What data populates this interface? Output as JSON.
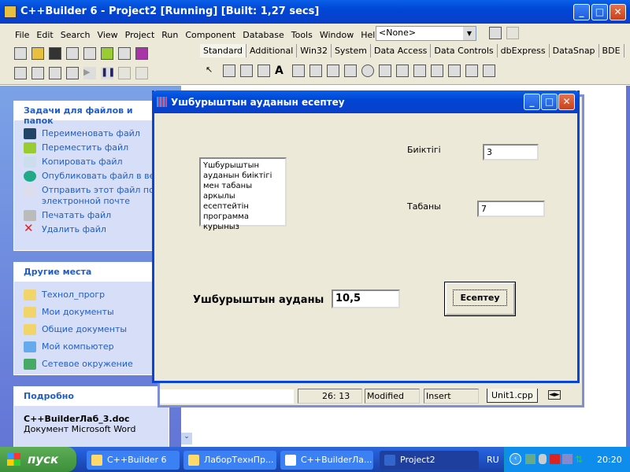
{
  "ide": {
    "title": "C++Builder 6 - Project2 [Running] [Built: 1,27 secs]",
    "menu": [
      "File",
      "Edit",
      "Search",
      "View",
      "Project",
      "Run",
      "Component",
      "Database",
      "Tools",
      "Window",
      "Help"
    ],
    "config_select": "<None>",
    "palette_tabs": [
      "Standard",
      "Additional",
      "Win32",
      "System",
      "Data Access",
      "Data Controls",
      "dbExpress",
      "DataSnap",
      "BDE"
    ],
    "status": {
      "position": "26:  13",
      "modified": "Modified",
      "mode": "Insert",
      "tab": "Unit1.cpp"
    }
  },
  "explorer": {
    "tasks": {
      "title": "Задачи для файлов и папок",
      "items": [
        "Переименовать файл",
        "Переместить файл",
        "Копировать файл",
        "Опубликовать файл в вебе",
        "Отправить этот файл по электронной почте",
        "Печатать файл",
        "Удалить файл"
      ]
    },
    "places": {
      "title": "Другие места",
      "items": [
        "Технол_прогр",
        "Мои документы",
        "Общие документы",
        "Мой компьютер",
        "Сетевое окружение"
      ]
    },
    "details": {
      "title": "Подробно",
      "filename": "C++BuilderЛаб_3.doc",
      "filetype": "Документ Microsoft Word"
    }
  },
  "dialog": {
    "title": "Ушбурыштын ауданын есептеу",
    "memo": "Үшбурыштын ауданын биіктігі мен табаны аркылы есептейтін программа курыныз",
    "height_label": "Биіктігі",
    "height_value": "3",
    "base_label": "Табаны",
    "base_value": "7",
    "area_label": "Ушбурыштын ауданы",
    "area_value": "10,5",
    "calc_button": "Есептеу"
  },
  "taskbar": {
    "start": "пуск",
    "tasks": [
      "C++Builder 6",
      "ЛаборТехнПр...",
      "C++BuilderЛа...",
      "Project2"
    ],
    "lang": "RU",
    "clock": "20:20"
  }
}
